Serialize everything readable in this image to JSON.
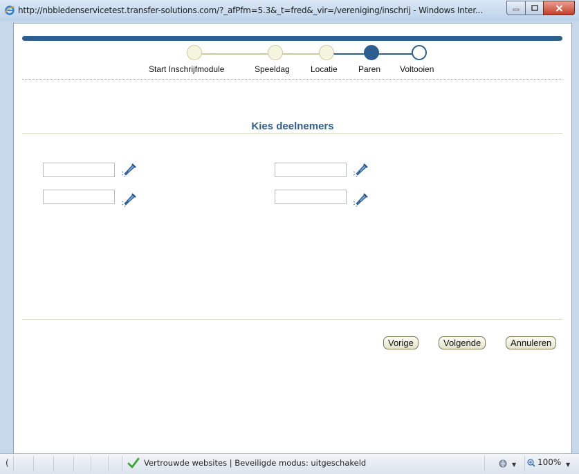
{
  "window": {
    "title": "http://nbbledenservicetest.transfer-solutions.com/?_afPfm=5.3&_t=fred&_vir=/vereniging/inschrij - Windows Inter..."
  },
  "train": {
    "steps": [
      {
        "label": "Start Inschrijfmodule",
        "state": "visited"
      },
      {
        "label": "Speeldag",
        "state": "visited"
      },
      {
        "label": "Locatie",
        "state": "visited"
      },
      {
        "label": "Paren",
        "state": "current"
      },
      {
        "label": "Voltooien",
        "state": "next"
      }
    ]
  },
  "heading": "Kies deelnemers",
  "fields": [
    {
      "value": ""
    },
    {
      "value": ""
    },
    {
      "value": ""
    },
    {
      "value": ""
    }
  ],
  "buttons": {
    "previous": "Vorige",
    "next": "Volgende",
    "cancel": "Annuleren"
  },
  "statusbar": {
    "first_char": "(",
    "security_text": "Vertrouwde websites | Beveiligde modus: uitgeschakeld",
    "zoom": "100%"
  },
  "colors": {
    "accent": "#2c5f8f",
    "heading": "#33608f",
    "visited_stop": "#f4f5df"
  }
}
